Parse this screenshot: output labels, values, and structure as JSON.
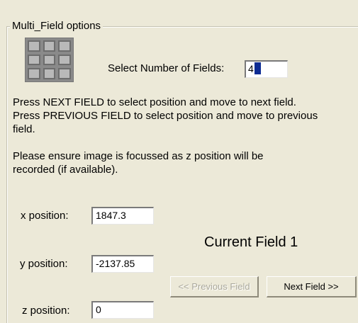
{
  "group": {
    "title": "Multi_Field options"
  },
  "count": {
    "label": "Select Number of Fields:",
    "value": "4"
  },
  "instructions": {
    "line1": "Press NEXT FIELD to select position and move to next field.",
    "line2": "Press PREVIOUS FIELD to select position and move to previous field.",
    "line3": "Please ensure image is focussed as z position will be recorded (if available)."
  },
  "positions": {
    "x_label": "x position:",
    "x_value": "1847.3",
    "y_label": "y position:",
    "y_value": "-2137.85",
    "z_label": "z position:",
    "z_value": "0"
  },
  "status": {
    "current_field": "Current Field 1"
  },
  "buttons": {
    "previous": "<< Previous Field",
    "next": "Next Field >>"
  },
  "icons": {
    "field_grid": "grid-icon"
  },
  "colors": {
    "window_bg": "#ece9d8",
    "field_bg": "#ffffff",
    "selection": "#0d2b93",
    "disabled_text": "#aaa89b"
  }
}
